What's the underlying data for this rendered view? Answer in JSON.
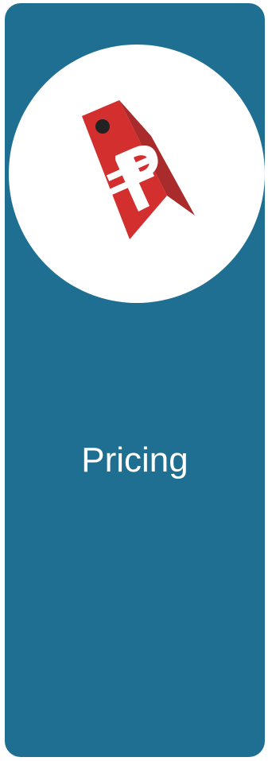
{
  "card": {
    "title": "Pricing",
    "icon": "price-tag-icon",
    "background_color": "#1f6f93",
    "text_color": "#ffffff",
    "icon_bg_color": "#ffffff",
    "tag_color": "#d32f2f"
  }
}
